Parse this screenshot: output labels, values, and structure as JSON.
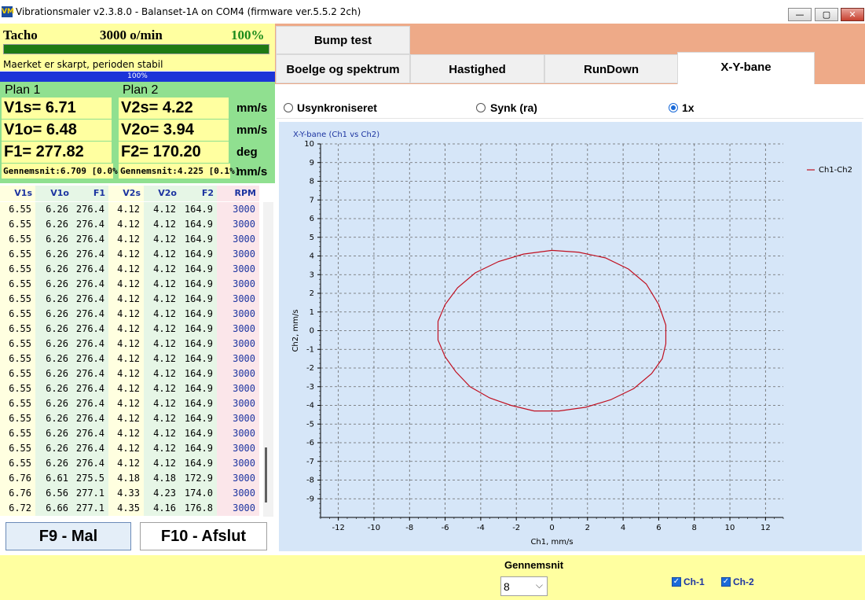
{
  "window": {
    "title": "Vibrationsmaler v2.3.8.0 - Balanset-1A on COM4 (firmware ver.5.5.2 2ch)",
    "icon_text": "VM",
    "minimize_glyph": "—",
    "maximize_glyph": "▢",
    "close_glyph": "✕"
  },
  "tacho": {
    "label": "Tacho",
    "rpm": "3000 o/min",
    "percent": "100%",
    "bar_fill_fraction": 1.0,
    "status": "Maerket er skarpt, perioden stabil",
    "progress_text": "100%",
    "progress_fill_fraction": 1.0
  },
  "plan1": {
    "title": "Plan 1",
    "v1s": "V1s= 6.71",
    "v1o": "V1o= 6.48",
    "f1": "F1= 277.82",
    "avg": "Gennemsnit:6.709 [0.0%]"
  },
  "plan2": {
    "title": "Plan 2",
    "v2s": "V2s= 4.22",
    "v2o": "V2o= 3.94",
    "f2": "F2= 170.20",
    "avg": "Gennemsnit:4.225 [0.1%]"
  },
  "units": [
    "mm/s",
    "mm/s",
    "deg",
    "mm/s"
  ],
  "table": {
    "headers": [
      "V1s",
      "V1o",
      "F1",
      "V2s",
      "V2o",
      "F2",
      "RPM"
    ],
    "rows": [
      [
        "6.55",
        "6.26",
        "276.4",
        "4.12",
        "4.12",
        "164.9",
        "3000"
      ],
      [
        "6.55",
        "6.26",
        "276.4",
        "4.12",
        "4.12",
        "164.9",
        "3000"
      ],
      [
        "6.55",
        "6.26",
        "276.4",
        "4.12",
        "4.12",
        "164.9",
        "3000"
      ],
      [
        "6.55",
        "6.26",
        "276.4",
        "4.12",
        "4.12",
        "164.9",
        "3000"
      ],
      [
        "6.55",
        "6.26",
        "276.4",
        "4.12",
        "4.12",
        "164.9",
        "3000"
      ],
      [
        "6.55",
        "6.26",
        "276.4",
        "4.12",
        "4.12",
        "164.9",
        "3000"
      ],
      [
        "6.55",
        "6.26",
        "276.4",
        "4.12",
        "4.12",
        "164.9",
        "3000"
      ],
      [
        "6.55",
        "6.26",
        "276.4",
        "4.12",
        "4.12",
        "164.9",
        "3000"
      ],
      [
        "6.55",
        "6.26",
        "276.4",
        "4.12",
        "4.12",
        "164.9",
        "3000"
      ],
      [
        "6.55",
        "6.26",
        "276.4",
        "4.12",
        "4.12",
        "164.9",
        "3000"
      ],
      [
        "6.55",
        "6.26",
        "276.4",
        "4.12",
        "4.12",
        "164.9",
        "3000"
      ],
      [
        "6.55",
        "6.26",
        "276.4",
        "4.12",
        "4.12",
        "164.9",
        "3000"
      ],
      [
        "6.55",
        "6.26",
        "276.4",
        "4.12",
        "4.12",
        "164.9",
        "3000"
      ],
      [
        "6.55",
        "6.26",
        "276.4",
        "4.12",
        "4.12",
        "164.9",
        "3000"
      ],
      [
        "6.55",
        "6.26",
        "276.4",
        "4.12",
        "4.12",
        "164.9",
        "3000"
      ],
      [
        "6.55",
        "6.26",
        "276.4",
        "4.12",
        "4.12",
        "164.9",
        "3000"
      ],
      [
        "6.55",
        "6.26",
        "276.4",
        "4.12",
        "4.12",
        "164.9",
        "3000"
      ],
      [
        "6.55",
        "6.26",
        "276.4",
        "4.12",
        "4.12",
        "164.9",
        "3000"
      ],
      [
        "6.76",
        "6.61",
        "275.5",
        "4.18",
        "4.18",
        "172.9",
        "3000"
      ],
      [
        "6.76",
        "6.56",
        "277.1",
        "4.33",
        "4.23",
        "174.0",
        "3000"
      ],
      [
        "6.72",
        "6.66",
        "277.1",
        "4.35",
        "4.16",
        "176.8",
        "3000"
      ]
    ]
  },
  "buttons": {
    "f9": "F9 - Mal",
    "f10": "F10 - Afslut"
  },
  "tabs": {
    "top": [
      "Bump test"
    ],
    "bottom": [
      "Boelge og spektrum",
      "Hastighed",
      "RunDown",
      "X-Y-bane"
    ],
    "active": "X-Y-bane"
  },
  "radios": {
    "options": [
      "Usynkroniseret",
      "Synk (ra)",
      "1x"
    ],
    "selected": "1x"
  },
  "bottom": {
    "avg_label": "Gennemsnit",
    "avg_value": "8",
    "chevron": "⌵",
    "ch1": "Ch-1",
    "ch2": "Ch-2",
    "check_glyph": "✓"
  },
  "colors": {
    "accent_green": "#1e7a14",
    "progress_blue": "#1c34d8",
    "panel_yellow": "#ffffa0",
    "panel_green": "#90e090",
    "tab_bg": "#eeaa88",
    "chart_bg": "#d6e6f8",
    "series_red": "#c01020",
    "header_blue": "#1c34a0"
  },
  "chart_data": {
    "type": "line",
    "title": "X-Y-bane (Ch1 vs Ch2)",
    "xlabel": "Ch1, mm/s",
    "ylabel": "Ch2, mm/s",
    "xlim": [
      -13,
      13
    ],
    "ylim": [
      -10,
      10
    ],
    "xticks": [
      -12,
      -10,
      -8,
      -6,
      -4,
      -2,
      0,
      2,
      4,
      6,
      8,
      10,
      12
    ],
    "yticks": [
      -9,
      -8,
      -7,
      -6,
      -5,
      -4,
      -3,
      -2,
      -1,
      0,
      1,
      2,
      3,
      4,
      5,
      6,
      7,
      8,
      9,
      10
    ],
    "grid": true,
    "legend": "top-right",
    "series": [
      {
        "name": "Ch1-Ch2",
        "color": "#c01020",
        "x": [
          6.4,
          6.2,
          5.6,
          4.6,
          3.3,
          1.9,
          0.4,
          -1.0,
          -2.3,
          -3.5,
          -4.6,
          -5.4,
          -6.0,
          -6.4,
          -6.4,
          -6.0,
          -5.3,
          -4.3,
          -3.0,
          -1.6,
          0.0,
          1.5,
          3.0,
          4.3,
          5.3,
          6.0,
          6.4
        ],
        "y": [
          -0.7,
          -1.5,
          -2.3,
          -3.1,
          -3.7,
          -4.1,
          -4.3,
          -4.3,
          -4.0,
          -3.6,
          -3.0,
          -2.2,
          -1.4,
          -0.5,
          0.5,
          1.4,
          2.3,
          3.1,
          3.7,
          4.1,
          4.3,
          4.2,
          3.9,
          3.3,
          2.5,
          1.4,
          0.3
        ]
      }
    ]
  }
}
